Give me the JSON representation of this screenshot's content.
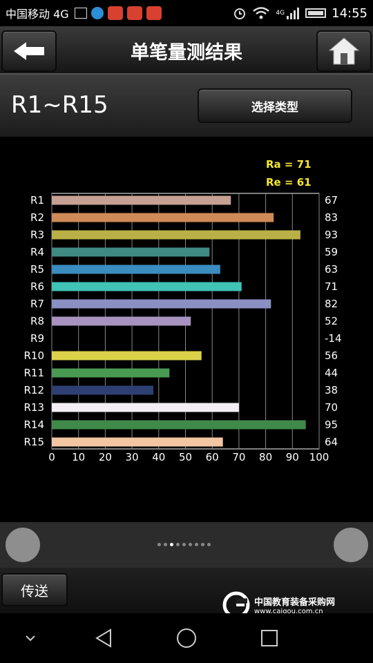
{
  "status_bar": {
    "carrier": "中国移动 4G",
    "network": "4G",
    "time": "14:55"
  },
  "header": {
    "title": "单笔量测结果",
    "back_icon": "arrow-left-icon",
    "home_icon": "home-icon"
  },
  "range": {
    "label": "R1~R15",
    "select_label": "选择类型"
  },
  "chart_data": {
    "type": "bar",
    "orientation": "horizontal",
    "annotations": [
      "Ra = 71",
      "Re = 61"
    ],
    "categories": [
      "R1",
      "R2",
      "R3",
      "R4",
      "R5",
      "R6",
      "R7",
      "R8",
      "R9",
      "R10",
      "R11",
      "R12",
      "R13",
      "R14",
      "R15"
    ],
    "values": [
      67,
      83,
      93,
      59,
      63,
      71,
      82,
      52,
      -14,
      56,
      44,
      38,
      70,
      95,
      64
    ],
    "value_labels": [
      "67",
      "83",
      "93",
      "59",
      "63",
      "71",
      "82",
      "52",
      "-14",
      "56",
      "44",
      "38",
      "70",
      "95",
      "64"
    ],
    "colors": [
      "#c6a093",
      "#d08a57",
      "#b9b047",
      "#3f8a83",
      "#3b8cbf",
      "#40c2b7",
      "#8b90c3",
      "#a893c0",
      "#888888",
      "#dcd24a",
      "#4a9a52",
      "#2e3f72",
      "#f3eef3",
      "#3f8a48",
      "#f2c6a2"
    ],
    "xticks": [
      "0",
      "10",
      "20",
      "30",
      "40",
      "50",
      "60",
      "70",
      "80",
      "90",
      "100"
    ],
    "xlim": [
      0,
      100
    ],
    "grid": true,
    "annotation_color": "#f5e632"
  },
  "pager": {
    "dots": 9,
    "active_index": 2
  },
  "footer": {
    "send_label": "传送",
    "watermark_name": "中国教育装备采购网",
    "watermark_url": "www.caigou.com.cn"
  }
}
